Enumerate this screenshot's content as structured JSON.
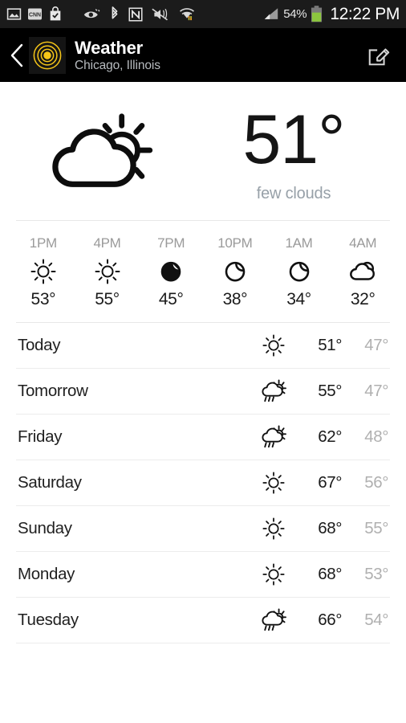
{
  "statusbar": {
    "left_icons": [
      {
        "name": "gallery-icon"
      },
      {
        "name": "cnn-news-icon",
        "label": "CNN"
      },
      {
        "name": "play-store-update-icon"
      }
    ],
    "mid_icons": [
      {
        "name": "smart-stay-eye-icon"
      },
      {
        "name": "bluetooth-icon"
      },
      {
        "name": "nfc-icon"
      },
      {
        "name": "sound-muted-vibrate-icon"
      },
      {
        "name": "wifi-data-transfer-icon"
      }
    ],
    "signal_icon": "cell-signal-icon",
    "battery_percent": "54%",
    "battery_icon": "battery-icon",
    "battery_color": "#8cc63e",
    "clock": "12:22 PM"
  },
  "appbar": {
    "back_icon": "back-chevron-icon",
    "app_icon": "weather-target-icon",
    "app_icon_color": "#f5c518",
    "title": "Weather",
    "subtitle": "Chicago, Illinois",
    "edit_icon": "edit-compose-icon"
  },
  "current": {
    "icon": "sun-behind-cloud-icon",
    "temperature": "51°",
    "description": "few clouds"
  },
  "hourly": [
    {
      "time": "1PM",
      "icon": "sun-icon",
      "temp": "53°"
    },
    {
      "time": "4PM",
      "icon": "sun-icon",
      "temp": "55°"
    },
    {
      "time": "7PM",
      "icon": "moon-icon",
      "temp": "45°"
    },
    {
      "time": "10PM",
      "icon": "moon-icon",
      "temp": "38°"
    },
    {
      "time": "1AM",
      "icon": "moon-icon",
      "temp": "34°"
    },
    {
      "time": "4AM",
      "icon": "cloud-moon-icon",
      "temp": "32°"
    }
  ],
  "daily": [
    {
      "day": "Today",
      "icon": "sun-icon",
      "high": "51°",
      "low": "47°"
    },
    {
      "day": "Tomorrow",
      "icon": "rain-sun-icon",
      "high": "55°",
      "low": "47°"
    },
    {
      "day": "Friday",
      "icon": "rain-sun-icon",
      "high": "62°",
      "low": "48°"
    },
    {
      "day": "Saturday",
      "icon": "sun-icon",
      "high": "67°",
      "low": "56°"
    },
    {
      "day": "Sunday",
      "icon": "sun-icon",
      "high": "68°",
      "low": "55°"
    },
    {
      "day": "Monday",
      "icon": "sun-icon",
      "high": "68°",
      "low": "53°"
    },
    {
      "day": "Tuesday",
      "icon": "rain-sun-icon",
      "high": "66°",
      "low": "54°"
    }
  ]
}
